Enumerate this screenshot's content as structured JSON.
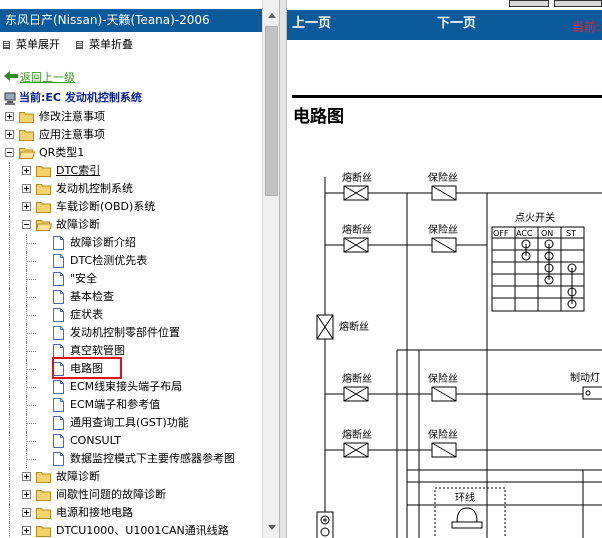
{
  "left_pane": {
    "title": "东风日产(Nissan)-天籁(Teana)-2006",
    "menu": {
      "expand": "菜单展开",
      "collapse": "菜单折叠"
    },
    "back_link": "返回上一级",
    "current_label": "当前:EC 发动机控制系统",
    "tree": [
      {
        "label": "修改注意事项",
        "type": "folder",
        "state": "collapsed",
        "level": 0
      },
      {
        "label": "应用注意事项",
        "type": "folder",
        "state": "collapsed",
        "level": 0
      },
      {
        "label": "QR类型1",
        "type": "folder",
        "state": "expanded",
        "level": 0
      },
      {
        "label": "DTC索引",
        "type": "folder",
        "state": "collapsed",
        "level": 1
      },
      {
        "label": "发动机控制系统",
        "type": "folder",
        "state": "collapsed",
        "level": 1
      },
      {
        "label": "车载诊断(OBD)系统",
        "type": "folder",
        "state": "collapsed",
        "level": 1
      },
      {
        "label": "故障诊断",
        "type": "folder",
        "state": "expanded",
        "level": 1
      },
      {
        "label": "故障诊断介绍",
        "type": "page",
        "level": 2
      },
      {
        "label": "DTC检测优先表",
        "type": "page",
        "level": 2
      },
      {
        "label": "\"安全",
        "type": "page",
        "level": 2
      },
      {
        "label": "基本检查",
        "type": "page",
        "level": 2
      },
      {
        "label": "症状表",
        "type": "page",
        "level": 2
      },
      {
        "label": "发动机控制零部件位置",
        "type": "page",
        "level": 2
      },
      {
        "label": "真空软管图",
        "type": "page",
        "level": 2
      },
      {
        "label": "电路图",
        "type": "page",
        "level": 2,
        "selected": true
      },
      {
        "label": "ECM线束接头端子布局",
        "type": "page",
        "level": 2
      },
      {
        "label": "ECM端子和参考值",
        "type": "page",
        "level": 2
      },
      {
        "label": "通用查询工具(GST)功能",
        "type": "page",
        "level": 2
      },
      {
        "label": "CONSULT",
        "type": "page",
        "level": 2
      },
      {
        "label": "数据监控模式下主要传感器参考图",
        "type": "page",
        "level": 2
      },
      {
        "label": "故障诊断",
        "type": "folder",
        "state": "collapsed",
        "level": 1
      },
      {
        "label": "间歇性问题的故障诊断",
        "type": "folder",
        "state": "collapsed",
        "level": 1
      },
      {
        "label": "电源和接地电路",
        "type": "folder",
        "state": "collapsed",
        "level": 1
      },
      {
        "label": "DTCU1000、U1001CAN通讯线路",
        "type": "folder",
        "state": "collapsed",
        "level": 1
      }
    ]
  },
  "right_pane": {
    "nav": {
      "prev": "上一页",
      "next": "下一页",
      "current": "当前:"
    },
    "doc_title": "电路图",
    "diagram": {
      "fuse_label": "熔断丝",
      "fusible_link_label": "保险丝",
      "ignition_switch": "点火开关",
      "ignition_positions": [
        "OFF",
        "ACC",
        "ON",
        "ST"
      ],
      "stop_lamp": "制动灯",
      "ring_label": "环线"
    }
  },
  "colors": {
    "header_blue": "#0a5a9c",
    "highlight_red": "#e01010",
    "link_green": "#3a9a1e",
    "current_blue": "#0a1f8f"
  }
}
